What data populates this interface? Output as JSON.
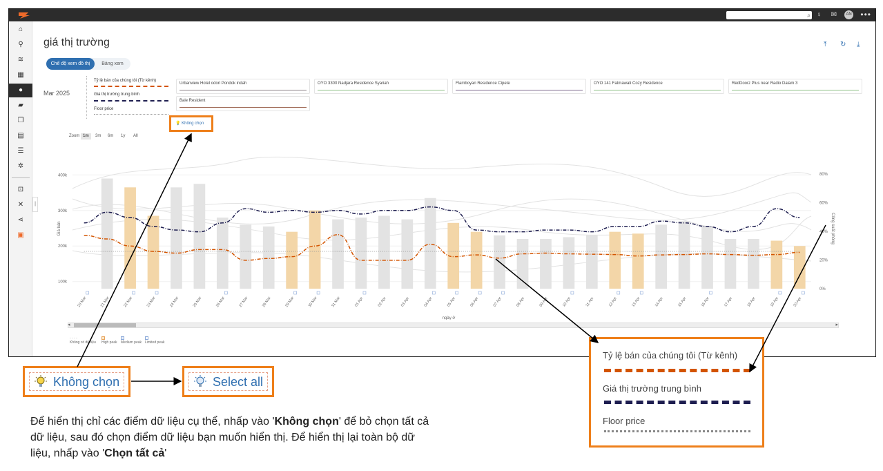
{
  "page": {
    "title": "giá thị trường",
    "view_toggle": {
      "chart": "Chế độ xem đồ thị",
      "table": "Bảng xem"
    },
    "month": "Mar 2025",
    "no_select_small": "Không chọn",
    "zoom": {
      "label": "Zoom",
      "options": [
        "1m",
        "3m",
        "6m",
        "1y",
        "All"
      ],
      "selected": "1m"
    }
  },
  "topbar": {
    "avatar": "AN"
  },
  "legend": {
    "our_rate": "Tỷ lệ bán của chúng tôi (Từ kênh)",
    "market_avg": "Giá thị trường trung bình",
    "floor": "Floor price"
  },
  "hotels": [
    {
      "name": "Urbanview Hotel odori Pondok indah",
      "color": "#8a7f86"
    },
    {
      "name": "OYO 3300 Nadjara Residence Syariah",
      "color": "#8cc084"
    },
    {
      "name": "Flamboyan Residence Cipete",
      "color": "#7e6a8e"
    },
    {
      "name": "OYO 141 Fatmawati Cozy Residence",
      "color": "#8cc084"
    },
    {
      "name": "RedDoorz Plus near Radio Dalam 3",
      "color": "#8cc084"
    },
    {
      "name": "Bale Resident",
      "color": "#a06a55"
    }
  ],
  "peak_legend": [
    "Không có dữ liệu",
    "High peak",
    "Medium peak",
    "Limited peak"
  ],
  "callouts": {
    "no_select": "Không chọn",
    "select_all": "Select all",
    "zoom_our_rate": "Tỷ lệ bán của chúng tôi (Từ kênh)",
    "zoom_market": "Giá thị trường trung bình",
    "zoom_floor": "Floor price"
  },
  "instructions": {
    "p1": "Để hiển thị chỉ các điểm dữ liệu cụ thể, nhấp vào '",
    "b1": "Không chọn",
    "p2": "' để bỏ chọn tất cả dữ liệu, sau đó chọn điểm dữ liệu bạn muốn hiển thị. Để hiển thị lại toàn bộ dữ liệu, nhấp vào '",
    "b2": "Chọn tất cả",
    "p3": "'"
  },
  "chart_data": {
    "type": "bar",
    "xlabel": "ngày ở",
    "ylabel": "Giá bán",
    "y2label": "Công suất phòng",
    "yticks": [
      "100k",
      "200k",
      "300k",
      "400k"
    ],
    "y2ticks": [
      "0%",
      "20%",
      "40%",
      "60%",
      "80%"
    ],
    "ylim": [
      80000,
      420000
    ],
    "categories": [
      "20 Mar",
      "21 Mar",
      "22 Mar",
      "23 Mar",
      "24 Mar",
      "25 Mar",
      "26 Mar",
      "27 Mar",
      "28 Mar",
      "29 Mar",
      "30 Mar",
      "31 Mar",
      "01 Apr",
      "02 Apr",
      "03 Apr",
      "04 Apr",
      "05 Apr",
      "06 Apr",
      "07 Apr",
      "08 Apr",
      "09 Apr",
      "10 Apr",
      "11 Apr",
      "12 Apr",
      "13 Apr",
      "14 Apr",
      "15 Apr",
      "16 Apr",
      "17 Apr",
      "18 Apr",
      "19 Apr",
      "20 Apr"
    ],
    "bar_values": [
      0,
      390000,
      365000,
      285000,
      365000,
      375000,
      280000,
      260000,
      255000,
      240000,
      300000,
      275000,
      280000,
      285000,
      275000,
      335000,
      265000,
      240000,
      230000,
      220000,
      220000,
      225000,
      230000,
      240000,
      235000,
      260000,
      270000,
      255000,
      220000,
      220000,
      215000,
      200000
    ],
    "bar_peak": [
      "none",
      "none",
      "high",
      "high",
      "none",
      "none",
      "none",
      "none",
      "none",
      "high",
      "high",
      "none",
      "none",
      "none",
      "none",
      "none",
      "high",
      "high",
      "none",
      "none",
      "none",
      "none",
      "none",
      "high",
      "high",
      "none",
      "none",
      "none",
      "none",
      "none",
      "high",
      "high"
    ],
    "series": [
      {
        "name": "Tỷ lệ bán của chúng tôi (Từ kênh)",
        "values": [
          230000,
          220000,
          200000,
          185000,
          180000,
          190000,
          190000,
          160000,
          165000,
          170000,
          200000,
          232000,
          160000,
          160000,
          160000,
          205000,
          170000,
          175000,
          166000,
          178000,
          180000,
          178000,
          177000,
          176000,
          172000,
          175000,
          176000,
          178000,
          176000,
          174000,
          176000,
          182000
        ]
      },
      {
        "name": "Giá thị trường trung bình",
        "values": [
          265000,
          295000,
          280000,
          255000,
          245000,
          240000,
          265000,
          305000,
          295000,
          300000,
          295000,
          300000,
          290000,
          300000,
          300000,
          310000,
          300000,
          245000,
          240000,
          240000,
          245000,
          245000,
          240000,
          255000,
          255000,
          270000,
          265000,
          255000,
          240000,
          255000,
          305000,
          280000
        ]
      },
      {
        "name": "Floor price",
        "values": [
          185000,
          185000,
          185000,
          185000,
          185000,
          185000,
          185000,
          185000,
          185000,
          185000,
          185000,
          185000,
          185000,
          185000,
          185000,
          185000,
          185000,
          185000,
          185000,
          185000,
          185000,
          185000,
          185000,
          185000,
          185000,
          185000,
          185000,
          185000,
          185000,
          185000,
          185000,
          185000
        ]
      }
    ],
    "colors": {
      "our_rate": "#d35400",
      "market_avg": "#1e1e50",
      "floor": "#999999",
      "bar_none": "#e3e3e3",
      "bar_high": "#f3d6a8"
    }
  }
}
